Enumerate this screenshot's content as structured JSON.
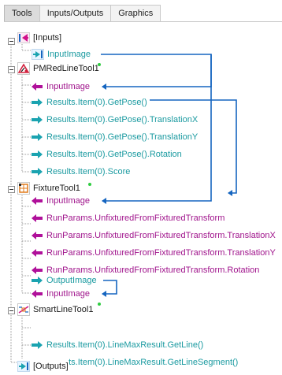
{
  "tabs": [
    {
      "label": "Tools",
      "active": true
    },
    {
      "label": "Inputs/Outputs",
      "active": false
    },
    {
      "label": "Graphics",
      "active": false
    }
  ],
  "tree": {
    "inputs_label": "[Inputs]",
    "input_image": "InputImage",
    "pmred": {
      "name": "PMRedLineTool1",
      "input": "InputImage",
      "outputs": [
        "Results.Item(0).GetPose()",
        "Results.Item(0).GetPose().TranslationX",
        "Results.Item(0).GetPose().TranslationY",
        "Results.Item(0).GetPose().Rotation",
        "Results.Item(0).Score"
      ]
    },
    "fixture": {
      "name": "FixtureTool1",
      "input": "InputImage",
      "params": [
        "RunParams.UnfixturedFromFixturedTransform",
        "RunParams.UnfixturedFromFixturedTransform.TranslationX",
        "RunParams.UnfixturedFromFixturedTransform.TranslationY",
        "RunParams.UnfixturedFromFixturedTransform.Rotation"
      ],
      "output": "OutputImage"
    },
    "smartline": {
      "name": "SmartLineTool1",
      "input": "InputImage",
      "outputs": [
        "Results.Item(0).LineMaxResult.GetLine()",
        "Results.Item(0).LineMaxResult.GetLineSegment()"
      ]
    },
    "outputs_label": "[Outputs]"
  },
  "colors": {
    "link_blue": "#1565c0",
    "input_magenta": "#b0109a",
    "output_cyan": "#1aa3b0",
    "status_green": "#2ecc40"
  }
}
